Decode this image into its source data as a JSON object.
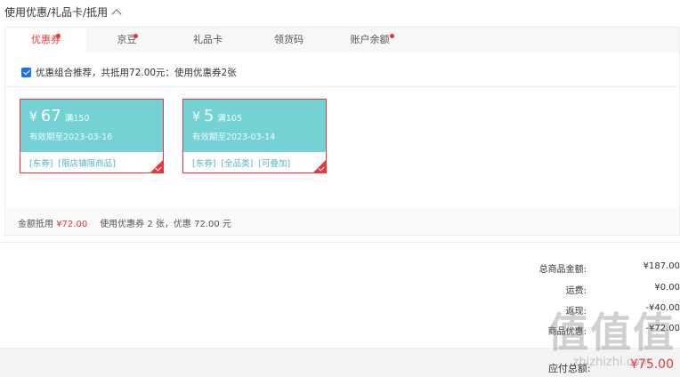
{
  "section": {
    "title": "使用优惠/礼品卡/抵用"
  },
  "tabs": [
    {
      "label": "优惠券",
      "active": true,
      "dot": true
    },
    {
      "label": "京豆",
      "active": false,
      "dot": true
    },
    {
      "label": "礼品卡",
      "active": false,
      "dot": false
    },
    {
      "label": "领货码",
      "active": false,
      "dot": false
    },
    {
      "label": "账户余额",
      "active": false,
      "dot": true
    }
  ],
  "combo": {
    "checked": true,
    "text": "优惠组合推荐，共抵用72.00元：使用优惠券2张"
  },
  "coupons": [
    {
      "currency": "¥",
      "amount": "67",
      "condition": "满150",
      "expiry": "有效期至2023-03-16",
      "tags": [
        "[东券]",
        "[限店铺限商品]"
      ]
    },
    {
      "currency": "¥",
      "amount": "5",
      "condition": "满105",
      "expiry": "有效期至2023-03-14",
      "tags": [
        "[东券]",
        "[全品类]",
        "[可叠加]"
      ]
    }
  ],
  "panel_footer": {
    "label": "金额抵用",
    "amount": "¥72.00",
    "summary": "使用优惠券 2 张，优惠 72.00 元"
  },
  "summary": [
    {
      "label": "总商品金额:",
      "value": "¥187.00"
    },
    {
      "label": "运费:",
      "value": "¥0.00"
    },
    {
      "label": "返现:",
      "value": "-¥40.00"
    },
    {
      "label": "商品优惠:",
      "value": "-¥72.00"
    }
  ],
  "payable": {
    "label": "应付总额:",
    "value": "¥75.00"
  },
  "watermark": {
    "chars": "值值值",
    "url": "zhizhizhi.com"
  },
  "colors": {
    "accent": "#e4393c",
    "coupon": "#74d2d4",
    "tag": "#59b3c3"
  }
}
